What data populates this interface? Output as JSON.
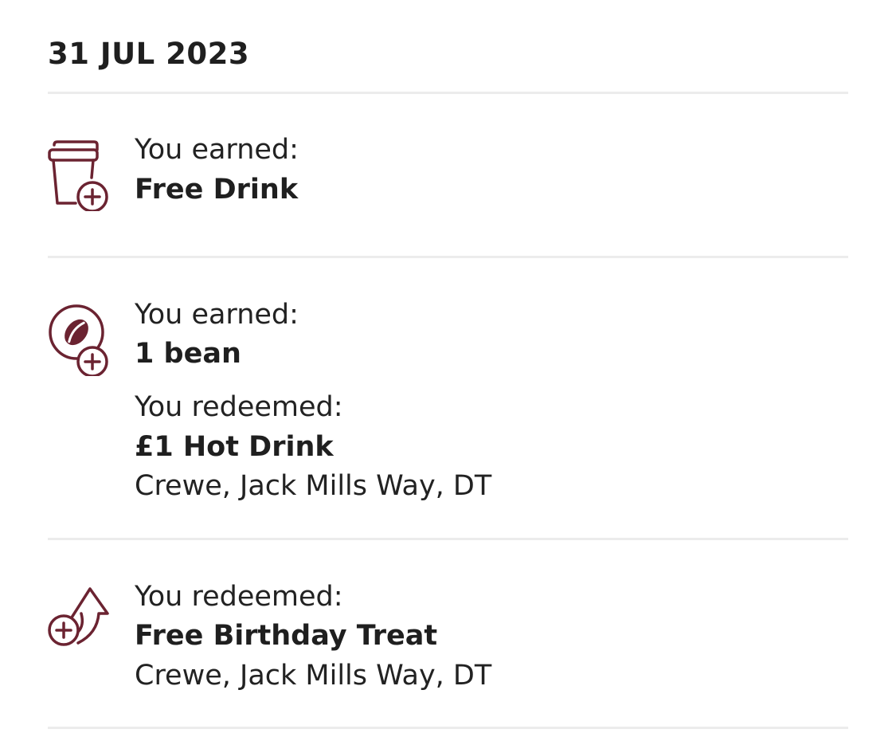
{
  "date": "31 JUL 2023",
  "colors": {
    "icon": "#6b2331",
    "divider": "#ececec",
    "text": "#222222"
  },
  "entries": [
    {
      "icon": "cup-plus-icon",
      "earned_label": "You earned:",
      "earned_value": "Free Drink"
    },
    {
      "icon": "bean-plus-icon",
      "earned_label": "You earned:",
      "earned_value": "1 bean",
      "redeemed_label": "You redeemed:",
      "redeemed_value": "£1 Hot Drink",
      "location": "Crewe, Jack Mills Way, DT"
    },
    {
      "icon": "redeem-arrow-icon",
      "redeemed_label": "You redeemed:",
      "redeemed_value": "Free Birthday Treat",
      "location": "Crewe, Jack Mills Way, DT"
    }
  ]
}
